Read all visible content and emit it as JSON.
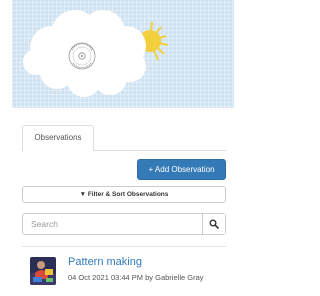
{
  "tabs": [
    {
      "label": "Observations",
      "active": true
    }
  ],
  "actions": {
    "add_observation_label": "+ Add Observation",
    "filter_sort_label": "▼ Filter & Sort Observations"
  },
  "search": {
    "placeholder": "Search",
    "value": "",
    "icon": "search-icon"
  },
  "observations": [
    {
      "title": "Pattern making",
      "meta": "04 Oct 2021 03:44 PM by Gabrielle Gray"
    }
  ],
  "colors": {
    "primary": "#337ab7",
    "banner_sky": "#cfe2f2",
    "sun": "#f3cf3d"
  }
}
